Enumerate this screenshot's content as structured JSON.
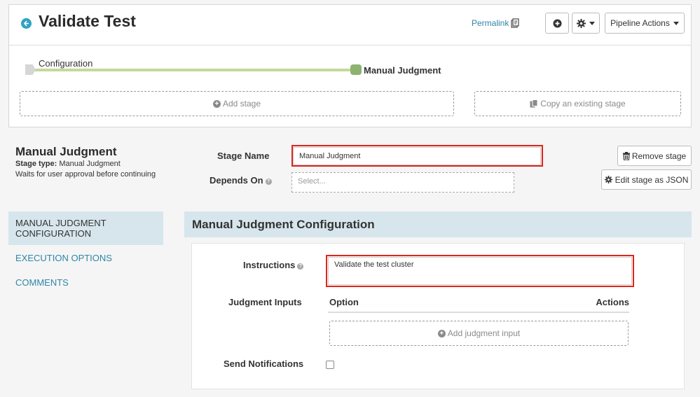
{
  "header": {
    "title": "Validate Test",
    "permalink_label": "Permalink",
    "pipeline_actions_label": "Pipeline Actions"
  },
  "graph": {
    "nodes": [
      {
        "label": "Configuration",
        "status": "inactive"
      },
      {
        "label": "Manual Judgment",
        "status": "active"
      }
    ],
    "add_stage_label": "Add stage",
    "copy_stage_label": "Copy an existing stage"
  },
  "stage": {
    "title": "Manual Judgment",
    "type_label": "Stage type:",
    "type_value": "Manual Judgment",
    "description": "Waits for user approval before continuing",
    "name_label": "Stage Name",
    "name_value": "Manual Judgment",
    "depends_label": "Depends On",
    "depends_placeholder": "Select...",
    "remove_label": "Remove stage",
    "edit_json_label": "Edit stage as JSON"
  },
  "nav": {
    "items": [
      {
        "label": "Manual Judgment Configuration",
        "active": true
      },
      {
        "label": "Execution Options",
        "active": false
      },
      {
        "label": "Comments",
        "active": false
      }
    ]
  },
  "config": {
    "section_title": "Manual Judgment Configuration",
    "instructions_label": "Instructions",
    "instructions_value": "Validate the test cluster",
    "judgment_inputs_label": "Judgment Inputs",
    "col_option": "Option",
    "col_actions": "Actions",
    "add_input_label": "Add judgment input",
    "send_notifications_label": "Send Notifications",
    "send_notifications_checked": false
  },
  "colors": {
    "accent": "#2fa2c2",
    "link": "#2f86a8",
    "highlight": "#e2231a",
    "graph_line": "#c5d89a",
    "active_node": "#8eb371",
    "section_bg": "#d7e6ec"
  }
}
